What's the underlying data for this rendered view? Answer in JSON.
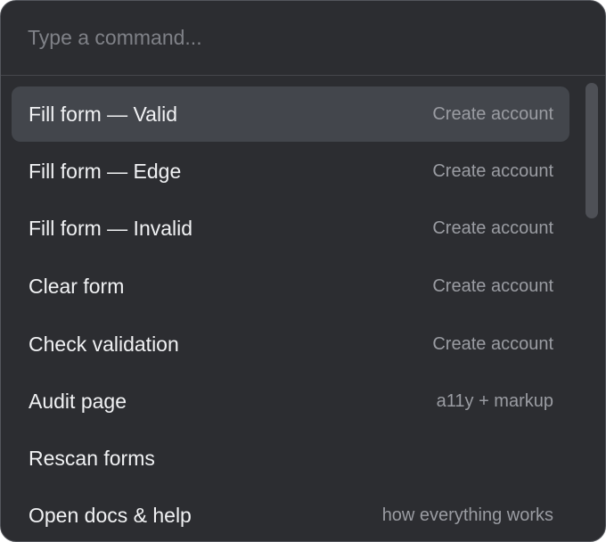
{
  "search": {
    "placeholder": "Type a command...",
    "value": ""
  },
  "commands": [
    {
      "label": "Fill form — Valid",
      "hint": "Create account",
      "selected": true
    },
    {
      "label": "Fill form — Edge",
      "hint": "Create account",
      "selected": false
    },
    {
      "label": "Fill form — Invalid",
      "hint": "Create account",
      "selected": false
    },
    {
      "label": "Clear form",
      "hint": "Create account",
      "selected": false
    },
    {
      "label": "Check validation",
      "hint": "Create account",
      "selected": false
    },
    {
      "label": "Audit page",
      "hint": "a11y + markup",
      "selected": false
    },
    {
      "label": "Rescan forms",
      "hint": "",
      "selected": false
    },
    {
      "label": "Open docs & help",
      "hint": "how everything works",
      "selected": false
    }
  ],
  "colors": {
    "background": "#2c2d31",
    "selected_row": "#43464c",
    "label_text": "#f1f2f4",
    "hint_text": "#9a9ca2"
  }
}
